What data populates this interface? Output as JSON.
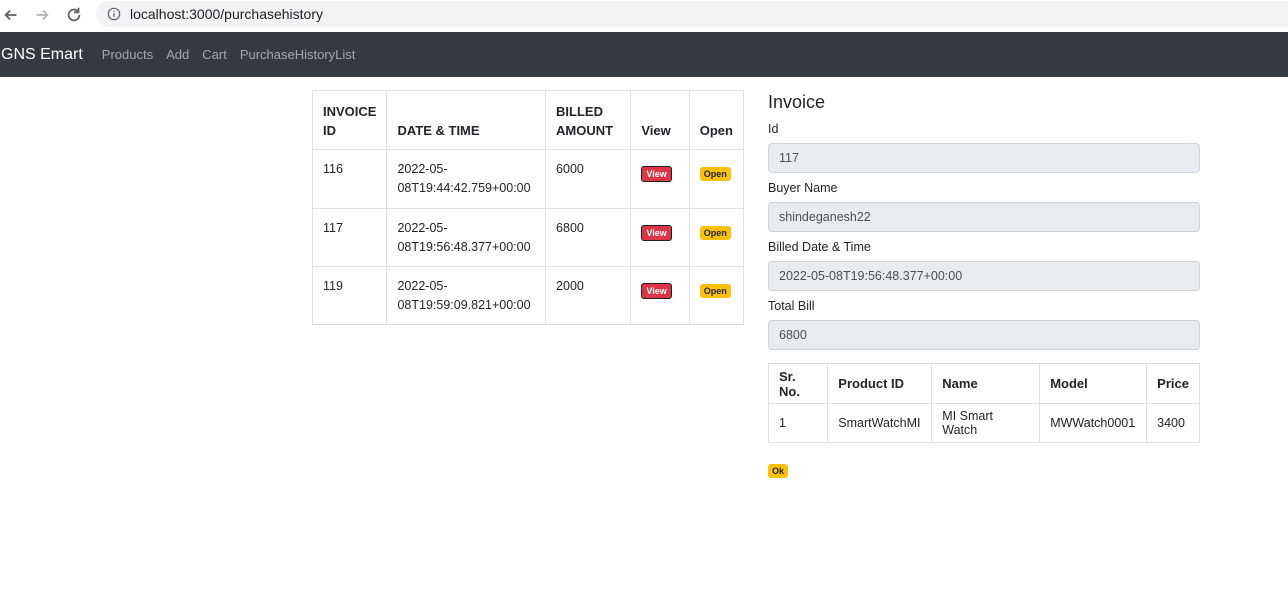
{
  "browser": {
    "url": "localhost:3000/purchasehistory",
    "back_icon": "arrow-left-icon",
    "forward_icon": "arrow-right-icon",
    "reload_icon": "reload-icon",
    "info_icon": "info-icon"
  },
  "navbar": {
    "brand": "GNS Emart",
    "links": [
      "Products",
      "Add",
      "Cart",
      "PurchaseHistoryList"
    ]
  },
  "history": {
    "headers": {
      "invoice_id": [
        "INVOICE",
        "ID"
      ],
      "date_time": "DATE & TIME",
      "billed_amount": [
        "BILLED",
        "AMOUNT"
      ],
      "view": "View",
      "open": "Open"
    },
    "rows": [
      {
        "id": "116",
        "date": [
          "2022-05-",
          "08T19:44:42.759+00:00"
        ],
        "amount": "6000",
        "view": "View",
        "open": "Open"
      },
      {
        "id": "117",
        "date": [
          "2022-05-",
          "08T19:56:48.377+00:00"
        ],
        "amount": "6800",
        "view": "View",
        "open": "Open"
      },
      {
        "id": "119",
        "date": [
          "2022-05-",
          "08T19:59:09.821+00:00"
        ],
        "amount": "2000",
        "view": "View",
        "open": "Open"
      }
    ]
  },
  "invoice": {
    "title": "Invoice",
    "id_label": "Id",
    "id_value": "117",
    "buyer_label": "Buyer Name",
    "buyer_value": "shindeganesh22",
    "date_label": "Billed Date & Time",
    "date_value": "2022-05-08T19:56:48.377+00:00",
    "total_label": "Total Bill",
    "total_value": "6800",
    "products": {
      "headers": [
        "Sr. No.",
        "Product ID",
        "Name",
        "Model",
        "Price"
      ],
      "rows": [
        [
          "1",
          "SmartWatchMI",
          "MI Smart Watch",
          "MWWatch0001",
          "3400"
        ]
      ]
    },
    "ok_label": "Ok"
  },
  "colors": {
    "navbar_bg": "#343a40",
    "danger": "#dc3545",
    "warning": "#ffc107",
    "readonly_bg": "#e9ecef"
  }
}
